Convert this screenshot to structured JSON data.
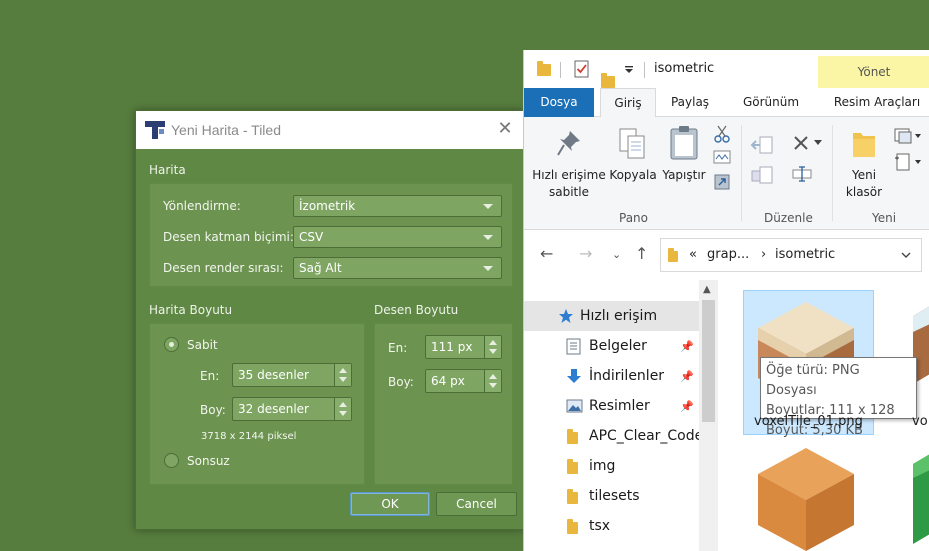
{
  "dialog": {
    "title": "Yeni Harita - Tiled",
    "close_glyph": "✕",
    "map_group": "Harita",
    "orientation": {
      "label": "Yönlendirme:",
      "value": "İzometrik"
    },
    "layer_format": {
      "label": "Desen katman biçimi:",
      "value": "CSV"
    },
    "render_order": {
      "label": "Desen render sırası:",
      "value": "Sağ Alt"
    },
    "map_size_group": "Harita Boyutu",
    "tile_size_group": "Desen Boyutu",
    "fixed_label": "Sabit",
    "width_label": "En:",
    "width_value": "35 desenler",
    "height_label": "Boy:",
    "height_value": "32 desenler",
    "pixel_size": "3718 x 2144 piksel",
    "infinite_label": "Sonsuz",
    "tile_width_label": "En:",
    "tile_width_value": "111 px",
    "tile_height_label": "Boy:",
    "tile_height_value": "64 px",
    "ok_label": "OK",
    "cancel_label": "Cancel"
  },
  "explorer": {
    "title": "isometric",
    "yonet_tab": "Yönet",
    "tabs": [
      "Dosya",
      "Giriş",
      "Paylaş",
      "Görünüm",
      "Resim Araçları"
    ],
    "ribbon": {
      "pin_label_1": "Hızlı erişime",
      "pin_label_2": "sabitle",
      "copy_label": "Kopyala",
      "paste_label": "Yapıştır",
      "pano_group": "Pano",
      "organize_group": "Düzenle",
      "new_folder_1": "Yeni",
      "new_folder_2": "klasör",
      "new_group": "Yeni"
    },
    "address": {
      "overflow": "«",
      "crumb_1": "grap...",
      "sep": "›",
      "crumb_2": "isometric"
    },
    "nav_items": [
      {
        "label": "Hızlı erişim"
      },
      {
        "label": "Belgeler"
      },
      {
        "label": "İndirilenler"
      },
      {
        "label": "Resimler"
      },
      {
        "label": "APC_Clear_Code"
      },
      {
        "label": "img"
      },
      {
        "label": "tilesets"
      },
      {
        "label": "tsx"
      }
    ],
    "tooltip": {
      "line1": "Öğe türü: PNG Dosyası",
      "line2": "Boyutlar: 111 x 128",
      "line3": "Boyut: 5,30 KB"
    },
    "file_label": "voxelTile_01.png",
    "file_label_2": "vo"
  }
}
